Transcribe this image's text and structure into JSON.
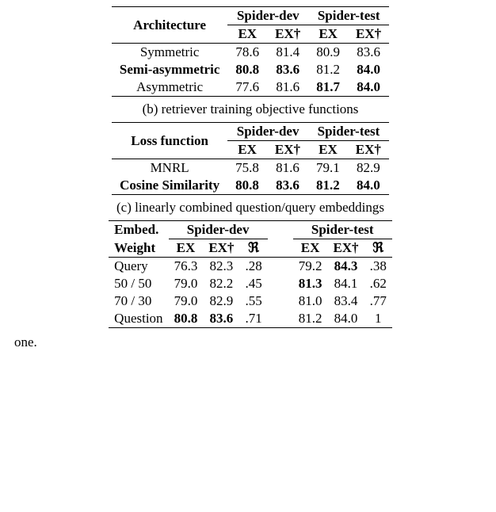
{
  "tableA": {
    "header_label": "Architecture",
    "group_dev": "Spider-dev",
    "group_test": "Spider-test",
    "sub_ex": "EX",
    "sub_exd": "EX†",
    "rows": [
      {
        "label": "Symmetric",
        "label_bold": false,
        "d_ex": "78.6",
        "d_ex_b": false,
        "d_exd": "81.4",
        "d_exd_b": false,
        "t_ex": "80.9",
        "t_ex_b": false,
        "t_exd": "83.6",
        "t_exd_b": false
      },
      {
        "label": "Semi-asymmetric",
        "label_bold": true,
        "d_ex": "80.8",
        "d_ex_b": true,
        "d_exd": "83.6",
        "d_exd_b": true,
        "t_ex": "81.2",
        "t_ex_b": false,
        "t_exd": "84.0",
        "t_exd_b": true
      },
      {
        "label": "Asymmetric",
        "label_bold": false,
        "d_ex": "77.6",
        "d_ex_b": false,
        "d_exd": "81.6",
        "d_exd_b": false,
        "t_ex": "81.7",
        "t_ex_b": true,
        "t_exd": "84.0",
        "t_exd_b": true
      }
    ]
  },
  "captionB": "(b) retriever training objective functions",
  "tableB": {
    "header_label": "Loss function",
    "group_dev": "Spider-dev",
    "group_test": "Spider-test",
    "sub_ex": "EX",
    "sub_exd": "EX†",
    "rows": [
      {
        "label": "MNRL",
        "label_bold": false,
        "d_ex": "75.8",
        "d_ex_b": false,
        "d_exd": "81.6",
        "d_exd_b": false,
        "t_ex": "79.1",
        "t_ex_b": false,
        "t_exd": "82.9",
        "t_exd_b": false
      },
      {
        "label": "Cosine Similarity",
        "label_bold": true,
        "d_ex": "80.8",
        "d_ex_b": true,
        "d_exd": "83.6",
        "d_exd_b": true,
        "t_ex": "81.2",
        "t_ex_b": true,
        "t_exd": "84.0",
        "t_exd_b": true
      }
    ]
  },
  "captionC": "(c) linearly combined question/query embeddings",
  "tableC": {
    "header_line1": "Embed.",
    "header_line2": "Weight",
    "group_dev": "Spider-dev",
    "group_test": "Spider-test",
    "sub_ex": "EX",
    "sub_exd": "EX†",
    "sub_r": "ℜ",
    "rows": [
      {
        "label": "Query",
        "d_ex": "76.3",
        "d_ex_b": false,
        "d_exd": "82.3",
        "d_exd_b": false,
        "d_r": ".28",
        "t_ex": "79.2",
        "t_ex_b": false,
        "t_exd": "84.3",
        "t_exd_b": true,
        "t_r": ".38"
      },
      {
        "label": "50 / 50",
        "d_ex": "79.0",
        "d_ex_b": false,
        "d_exd": "82.2",
        "d_exd_b": false,
        "d_r": ".45",
        "t_ex": "81.3",
        "t_ex_b": true,
        "t_exd": "84.1",
        "t_exd_b": false,
        "t_r": ".62"
      },
      {
        "label": "70 / 30",
        "d_ex": "79.0",
        "d_ex_b": false,
        "d_exd": "82.9",
        "d_exd_b": false,
        "d_r": ".55",
        "t_ex": "81.0",
        "t_ex_b": false,
        "t_exd": "83.4",
        "t_exd_b": false,
        "t_r": ".77"
      },
      {
        "label": "Question",
        "d_ex": "80.8",
        "d_ex_b": true,
        "d_exd": "83.6",
        "d_exd_b": true,
        "d_r": ".71",
        "t_ex": "81.2",
        "t_ex_b": false,
        "t_exd": "84.0",
        "t_exd_b": false,
        "t_r": "1"
      }
    ]
  },
  "footer_cut": "one.",
  "chart_data": [
    {
      "type": "table",
      "title": "Architecture comparison on Spider",
      "columns": [
        "Architecture",
        "Spider-dev EX",
        "Spider-dev EX†",
        "Spider-test EX",
        "Spider-test EX†"
      ],
      "rows": [
        [
          "Symmetric",
          78.6,
          81.4,
          80.9,
          83.6
        ],
        [
          "Semi-asymmetric",
          80.8,
          83.6,
          81.2,
          84.0
        ],
        [
          "Asymmetric",
          77.6,
          81.6,
          81.7,
          84.0
        ]
      ]
    },
    {
      "type": "table",
      "title": "(b) retriever training objective functions",
      "columns": [
        "Loss function",
        "Spider-dev EX",
        "Spider-dev EX†",
        "Spider-test EX",
        "Spider-test EX†"
      ],
      "rows": [
        [
          "MNRL",
          75.8,
          81.6,
          79.1,
          82.9
        ],
        [
          "Cosine Similarity",
          80.8,
          83.6,
          81.2,
          84.0
        ]
      ]
    },
    {
      "type": "table",
      "title": "(c) linearly combined question/query embeddings",
      "columns": [
        "Embed. Weight",
        "Spider-dev EX",
        "Spider-dev EX†",
        "Spider-dev ℜ",
        "Spider-test EX",
        "Spider-test EX†",
        "Spider-test ℜ"
      ],
      "rows": [
        [
          "Query",
          76.3,
          82.3,
          0.28,
          79.2,
          84.3,
          0.38
        ],
        [
          "50 / 50",
          79.0,
          82.2,
          0.45,
          81.3,
          84.1,
          0.62
        ],
        [
          "70 / 30",
          79.0,
          82.9,
          0.55,
          81.0,
          83.4,
          0.77
        ],
        [
          "Question",
          80.8,
          83.6,
          0.71,
          81.2,
          84.0,
          1
        ]
      ]
    }
  ]
}
